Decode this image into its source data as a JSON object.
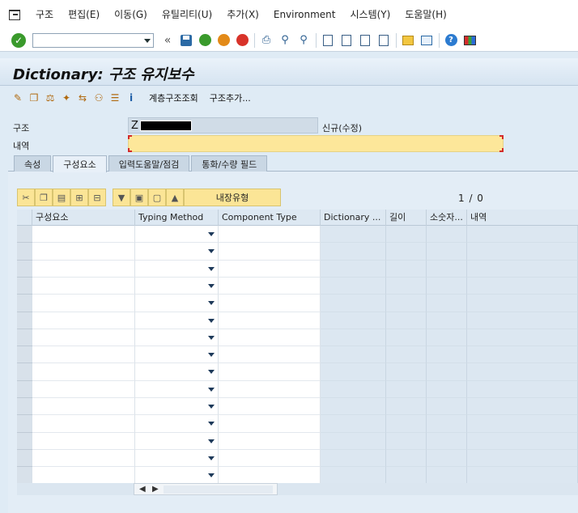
{
  "menu": {
    "items": [
      "구조",
      "편집(E)",
      "이동(G)",
      "유틸리티(U)",
      "추가(X)",
      "Environment",
      "시스템(Y)",
      "도움말(H)"
    ]
  },
  "toolbar": {
    "command_value": "",
    "icons": [
      "ok-icon",
      "command-field",
      "back-chevron-icon",
      "save-icon",
      "back-icon",
      "exit-icon",
      "cancel-icon",
      "print-icon",
      "find-icon",
      "find-next-icon",
      "first-page-icon",
      "prev-page-icon",
      "next-page-icon",
      "last-page-icon",
      "new-session-icon",
      "shortcut-icon",
      "help-icon",
      "layout-icon"
    ]
  },
  "title": "Dictionary: 구조 유지보수",
  "app_toolbar": {
    "hierarchy_label": "계층구조조회",
    "append_label": "구조추가..."
  },
  "header": {
    "structure_label": "구조",
    "structure_value": "Z",
    "status": "신규(수정)",
    "description_label": "내역",
    "description_value": ""
  },
  "tabs": [
    "속성",
    "구성요소",
    "입력도움말/점검",
    "통화/수량 필드"
  ],
  "active_tab": 1,
  "table_toolbar": {
    "builtin_label": "내장유형",
    "page_indicator": "1 / 0"
  },
  "grid": {
    "columns": [
      "구성요소",
      "Typing Method",
      "Component Type",
      "Dictionary ...",
      "길이",
      "소숫자...",
      "내역"
    ],
    "rows": [
      [
        "",
        "",
        "",
        "",
        "",
        "",
        ""
      ],
      [
        "",
        "",
        "",
        "",
        "",
        "",
        ""
      ],
      [
        "",
        "",
        "",
        "",
        "",
        "",
        ""
      ],
      [
        "",
        "",
        "",
        "",
        "",
        "",
        ""
      ],
      [
        "",
        "",
        "",
        "",
        "",
        "",
        ""
      ],
      [
        "",
        "",
        "",
        "",
        "",
        "",
        ""
      ],
      [
        "",
        "",
        "",
        "",
        "",
        "",
        ""
      ],
      [
        "",
        "",
        "",
        "",
        "",
        "",
        ""
      ],
      [
        "",
        "",
        "",
        "",
        "",
        "",
        ""
      ],
      [
        "",
        "",
        "",
        "",
        "",
        "",
        ""
      ],
      [
        "",
        "",
        "",
        "",
        "",
        "",
        ""
      ],
      [
        "",
        "",
        "",
        "",
        "",
        "",
        ""
      ],
      [
        "",
        "",
        "",
        "",
        "",
        "",
        ""
      ],
      [
        "",
        "",
        "",
        "",
        "",
        "",
        ""
      ],
      [
        "",
        "",
        "",
        "",
        "",
        "",
        ""
      ]
    ]
  },
  "colors": {
    "background": "#dfebf5",
    "required_field": "#fde79a",
    "table_button": "#fbe596",
    "readonly_cell": "#dce7f1"
  }
}
